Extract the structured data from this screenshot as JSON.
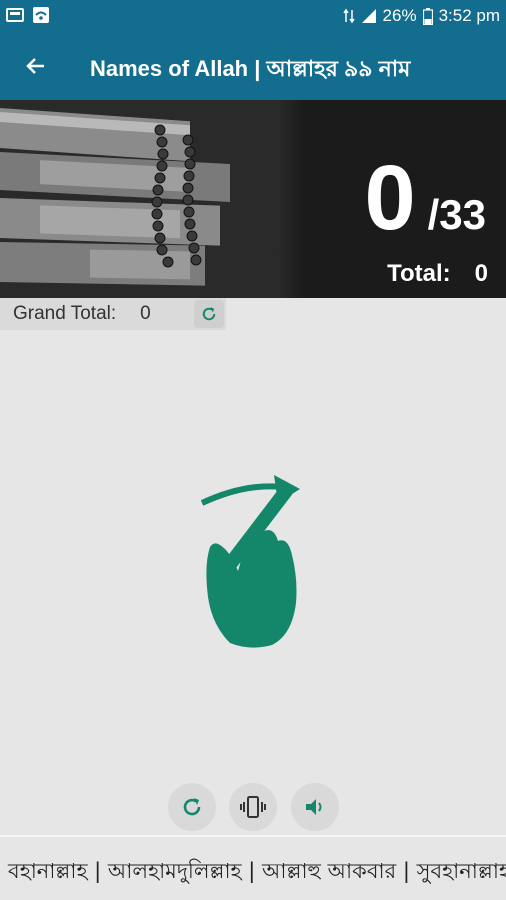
{
  "status_bar": {
    "battery": "26%",
    "time": "3:52 pm",
    "icons": [
      "notification-icon",
      "wifi-icon",
      "data-icon",
      "signal-icon",
      "battery-icon"
    ]
  },
  "app_bar": {
    "title": "Names of Allah | আল্লাহর ৯৯ নাম",
    "back_icon": "arrow-left-icon"
  },
  "counter": {
    "count": "0",
    "target": "/33",
    "total_label": "Total:",
    "total_value": "0"
  },
  "grand_total": {
    "label": "Grand Total:",
    "value": "0",
    "reset_icon": "refresh-icon"
  },
  "controls": [
    {
      "icon": "refresh-icon"
    },
    {
      "icon": "vibrate-icon"
    },
    {
      "icon": "volume-icon"
    }
  ],
  "ticker": {
    "text": "বহানাল্লাহ | আলহামদুলিল্লাহ | আল্লাহু আকবার | সুবহানাল্লাহ"
  },
  "colors": {
    "primary": "#136d8f",
    "accent": "#14876a",
    "background": "#e6e6e6"
  }
}
